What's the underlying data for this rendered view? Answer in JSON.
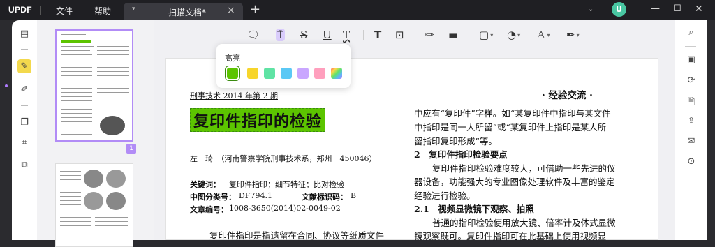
{
  "app": {
    "logo": "UPDF",
    "menu": [
      "文件",
      "帮助"
    ],
    "tab_title": "扫描文档*",
    "avatar_letter": "U"
  },
  "popup": {
    "label": "高亮",
    "swatches": [
      "#5cc400",
      "#f7d52b",
      "#5fe3a4",
      "#5bc8f5",
      "#c9a6ff",
      "#ff9fbd",
      "gradient"
    ]
  },
  "thumbnails": {
    "page_number": "1"
  },
  "document": {
    "header_left": "刑事技术 2014 年第 2 期",
    "header_right": "· 经验交流 ·",
    "title": "复印件指印的检验",
    "author_line": "左　琦　（河南警察学院刑事技术系，郑州　450046）",
    "keywords_label": "关键词：",
    "keywords": "复印件指印；细节特征；比对检验",
    "clc_label": "中图分类号：",
    "clc": "DF794.1",
    "doc_code_label": "文献标识码：",
    "doc_code": "B",
    "article_no_label": "文章编号：",
    "article_no": "1008-3650(2014)02-0049-02",
    "left_para_start": "复印件指印是指遗留在合同、协议等纸质文件",
    "right_lines": [
      "中应有“复印件”字样。如“某复印件中指印与某文件",
      "中指印是同一人所留”或“某复印件上指印是某人所",
      "留指印复印形成”等。"
    ],
    "section2_title": "2　复印件指印检验要点",
    "section2_lines": [
      "复印件指印检验难度较大，可借助一些先进的仪",
      "器设备，功能强大的专业图像处理软件及丰富的鉴定",
      "经验进行检验。"
    ],
    "section21_title": "2.1　视频显微镜下观察、拍照",
    "section21_lines": [
      "普通的指印检验使用放大镜、倍率计及体式显微",
      "镜观察既可。复印件指印可在此基础上使用视频显"
    ]
  }
}
